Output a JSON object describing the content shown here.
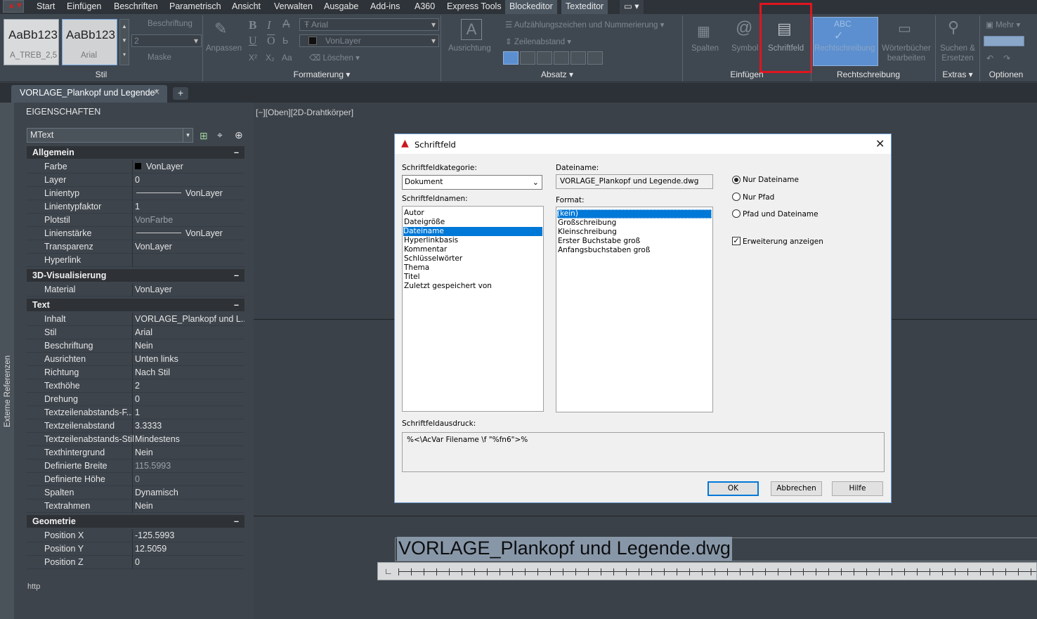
{
  "menubar": {
    "items": [
      "Start",
      "Einfügen",
      "Beschriften",
      "Parametrisch",
      "Ansicht",
      "Verwalten",
      "Ausgabe",
      "Add-ins",
      "A360",
      "Express Tools",
      "Blockeditor",
      "Texteditor"
    ]
  },
  "ribbon": {
    "styles": {
      "preview1": "AaBb123",
      "preview2": "AaBb123",
      "name1": "A_TREB_2,5",
      "name2": "Arial",
      "annotation": "Beschriftung",
      "height": "2",
      "mask": "Maske"
    },
    "format": {
      "font": "Arial",
      "color": "VonLayer",
      "bold": "B",
      "italic": "I",
      "underline": "U",
      "overline": "O",
      "strike": "A",
      "match": "Anpassen",
      "superscript": "X²",
      "subscript": "X₂",
      "case": "Aa",
      "delete": "Löschen"
    },
    "paragraph": {
      "justify": "Ausrichtung",
      "bullets": "Aufzählungszeichen und Nummerierung",
      "spacing": "Zeilenabstand"
    },
    "insert": {
      "columns": "Spalten",
      "symbol": "Symbol",
      "field": "Schriftfeld"
    },
    "spelling": {
      "check": "Rechtschreibung",
      "dict": "Wörterbücher bearbeiten"
    },
    "tools": {
      "find": "Suchen & Ersetzen",
      "more": "Mehr"
    },
    "groups": [
      "Stil",
      "Formatierung",
      "Absatz",
      "Einfügen",
      "Rechtschreibung",
      "Extras",
      "Optionen"
    ]
  },
  "tab": {
    "label": "VORLAGE_Plankopf und Legende*"
  },
  "properties": {
    "title": "EIGENSCHAFTEN",
    "selector": "MText",
    "side_label": "Externe Referenzen",
    "sections": [
      {
        "name": "Allgemein",
        "rows": [
          [
            "Farbe",
            "VonLayer"
          ],
          [
            "Layer",
            "0"
          ],
          [
            "Linientyp",
            "VonLayer"
          ],
          [
            "Linientypfaktor",
            "1"
          ],
          [
            "Plotstil",
            "VonFarbe"
          ],
          [
            "Linienstärke",
            "VonLayer"
          ],
          [
            "Transparenz",
            "VonLayer"
          ],
          [
            "Hyperlink",
            ""
          ]
        ]
      },
      {
        "name": "3D-Visualisierung",
        "rows": [
          [
            "Material",
            "VonLayer"
          ]
        ]
      },
      {
        "name": "Text",
        "rows": [
          [
            "Inhalt",
            "VORLAGE_Plankopf und L..."
          ],
          [
            "Stil",
            "Arial"
          ],
          [
            "Beschriftung",
            "Nein"
          ],
          [
            "Ausrichten",
            "Unten links"
          ],
          [
            "Richtung",
            "Nach Stil"
          ],
          [
            "Texthöhe",
            "2"
          ],
          [
            "Drehung",
            "0"
          ],
          [
            "Textzeilenabstands-F...",
            "1"
          ],
          [
            "Textzeilenabstand",
            "3.3333"
          ],
          [
            "Textzeilenabstands-Stil",
            "Mindestens"
          ],
          [
            "Texthintergrund",
            "Nein"
          ],
          [
            "Definierte Breite",
            "115.5993"
          ],
          [
            "Definierte Höhe",
            "0"
          ],
          [
            "Spalten",
            "Dynamisch"
          ],
          [
            "Textrahmen",
            "Nein"
          ]
        ]
      },
      {
        "name": "Geometrie",
        "rows": [
          [
            "Position X",
            "-125.5993"
          ],
          [
            "Position Y",
            "12.5059"
          ],
          [
            "Position Z",
            "0"
          ]
        ]
      }
    ],
    "footer": "http"
  },
  "viewport": {
    "label": "[−][Oben][2D-Drahtkörper]",
    "mtext": "VORLAGE_Plankopf und Legende.dwg"
  },
  "dialog": {
    "title": "Schriftfeld",
    "category_label": "Schriftfeldkategorie:",
    "category_value": "Dokument",
    "names_label": "Schriftfeldnamen:",
    "names": [
      "Autor",
      "Dateigröße",
      "Dateiname",
      "Hyperlinkbasis",
      "Kommentar",
      "Schlüsselwörter",
      "Thema",
      "Titel",
      "Zuletzt gespeichert von"
    ],
    "filename_label": "Dateiname:",
    "filename_value": "VORLAGE_Plankopf und Legende.dwg",
    "format_label": "Format:",
    "formats": [
      "(kein)",
      "Großschreibung",
      "Kleinschreibung",
      "Erster Buchstabe groß",
      "Anfangsbuchstaben groß"
    ],
    "radio": [
      "Nur Dateiname",
      "Nur Pfad",
      "Pfad und Dateiname"
    ],
    "checkbox": "Erweiterung anzeigen",
    "expr_label": "Schriftfeldausdruck:",
    "expr_value": "%<\\AcVar Filename \\f \"%fn6\">%",
    "ok": "OK",
    "cancel": "Abbrechen",
    "help": "Hilfe"
  }
}
